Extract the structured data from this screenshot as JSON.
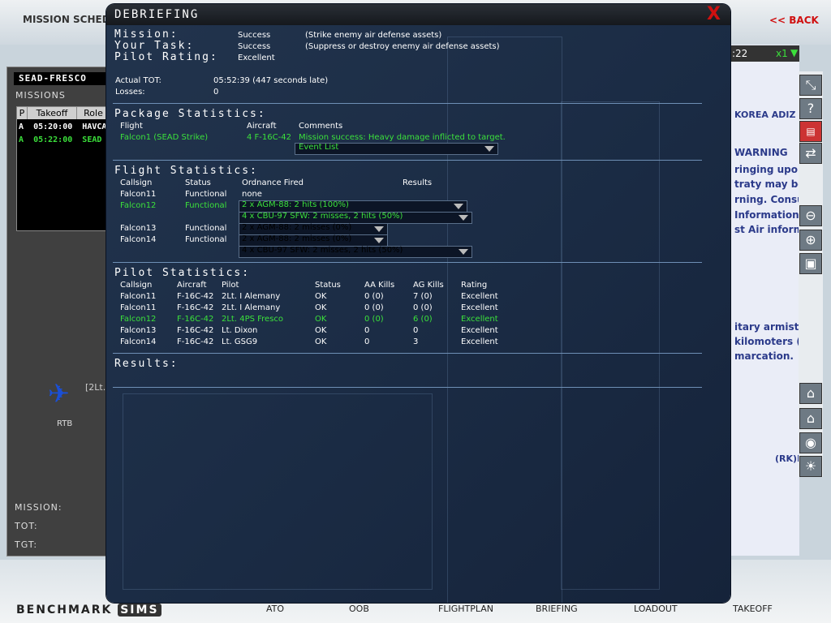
{
  "background": {
    "title": "MISSION SCHEDU",
    "back_label": "<< BACK",
    "left": {
      "sead_title": "SEAD-FRESCO",
      "missions_label": "MISSIONS",
      "headers": [
        "P",
        "Takeoff",
        "Role"
      ],
      "rows": [
        {
          "p": "A",
          "time": "05:20:00",
          "role": "HAVCA"
        },
        {
          "p": "A",
          "time": "05:22:00",
          "role": "SEAD S"
        }
      ],
      "pilot_text": "[2Lt.",
      "rtb": "RTB",
      "mission_label": "MISSION:",
      "tot_label": "TOT:",
      "tgt_label": "TGT:"
    },
    "right": {
      "time": ":22",
      "speed": "x1",
      "map_lines": [
        "KOREA ADIZ",
        "WARNING",
        "ringing upon",
        "traty may be f",
        "rning. Consul",
        "Information P",
        "st Air inform",
        "itary armistic",
        "kilomoters (",
        "marcation.",
        "(RK)R"
      ]
    },
    "nav": [
      "ATO",
      "OOB",
      "FLIGHTPLAN",
      "BRIEFING",
      "LOADOUT",
      "TAKEOFF"
    ],
    "logo_main": "BENCHMARK",
    "logo_sub": "SIMS"
  },
  "dialog": {
    "title": "DEBRIEFING",
    "close": "X",
    "mission_label": "Mission:",
    "mission_value": "Success",
    "mission_desc": "(Strike enemy air defense assets)",
    "task_label": "Your Task:",
    "task_value": "Success",
    "task_desc": "(Suppress or destroy enemy air defense assets)",
    "rating_label": "Pilot Rating:",
    "rating_value": "Excellent",
    "tot_label": "Actual TOT:",
    "tot_value": "05:52:39 (447 seconds late)",
    "losses_label": "Losses:",
    "losses_value": "0",
    "package": {
      "header": "Package Statistics:",
      "col_flight": "Flight",
      "col_aircraft": "Aircraft",
      "col_comments": "Comments",
      "flight": "Falcon1 (SEAD Strike)",
      "aircraft": "4 F-16C-42",
      "comment": "Mission success: Heavy damage inflicted to target.",
      "event_list": "Event List"
    },
    "flight_stats": {
      "header": "Flight Statistics:",
      "col_callsign": "Callsign",
      "col_status": "Status",
      "col_ordnance": "Ordnance Fired",
      "col_results": "Results",
      "rows": [
        {
          "callsign": "Falcon11",
          "status": "Functional",
          "ordnance": [
            "none"
          ]
        },
        {
          "callsign": "Falcon12",
          "status": "Functional",
          "ordnance": [
            "2 x AGM-88: 2 hits (100%)",
            "4 x CBU-97 SFW: 2 misses, 2 hits (50%)"
          ]
        },
        {
          "callsign": "Falcon13",
          "status": "Functional",
          "ordnance": [
            "2 x AGM-88: 2 misses (0%)"
          ]
        },
        {
          "callsign": "Falcon14",
          "status": "Functional",
          "ordnance": [
            "2 x AGM-88: 2 misses (0%)",
            "4 x CBU-97 SFW: 2 misses, 2 hits (50%)"
          ]
        }
      ]
    },
    "pilot_stats": {
      "header": "Pilot Statistics:",
      "cols": [
        "Callsign",
        "Aircraft",
        "Pilot",
        "Status",
        "AA Kills",
        "AG Kills",
        "Rating"
      ],
      "rows": [
        [
          "Falcon11",
          "F-16C-42",
          "2Lt. I Alemany",
          "OK",
          "0 (0)",
          "7 (0)",
          "Excellent"
        ],
        [
          "Falcon11",
          "F-16C-42",
          "2Lt. I Alemany",
          "OK",
          "0 (0)",
          "0 (0)",
          "Excellent"
        ],
        [
          "Falcon12",
          "F-16C-42",
          "2Lt. 4PS Fresco",
          "OK",
          "0 (0)",
          "6 (0)",
          "Excellent"
        ],
        [
          "Falcon13",
          "F-16C-42",
          "Lt. Dixon",
          "OK",
          "0",
          "0",
          "Excellent"
        ],
        [
          "Falcon14",
          "F-16C-42",
          "Lt. GSG9",
          "OK",
          "0",
          "3",
          "Excellent"
        ]
      ]
    },
    "results_header": "Results:"
  },
  "colors": {
    "highlight": "#3be03b",
    "back": "#d01010"
  }
}
